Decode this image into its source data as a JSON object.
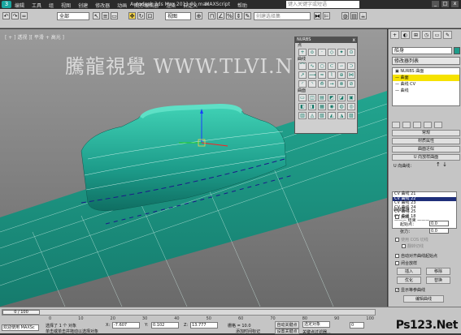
{
  "titlebar": {
    "logo": "3",
    "menus": [
      "编辑",
      "工具",
      "组",
      "视图",
      "创建",
      "修改器",
      "动画",
      "图形编辑器",
      "渲染",
      "自定义",
      "MAXScript",
      "帮助"
    ],
    "title": "Autodesk 3ds Max  2011     01.max",
    "search_placeholder": "键入关键字或短语",
    "min": "_",
    "max": "□",
    "close": "x"
  },
  "toolbar": {
    "selection_filter": "全部",
    "reference": "视图",
    "named_set": "创建选择集"
  },
  "viewport": {
    "label": "[ + ] 透视 ][ 平滑 + 高光 ]",
    "watermark": "騰龍視覺 WWW.TLVI.NET",
    "surface_color": "#1d9c8a"
  },
  "nurbs_panel": {
    "title": "NURBS",
    "point_label": "点",
    "curve_label": "曲线",
    "surface_label": "曲面",
    "close": "x",
    "point_tools": [
      "+",
      "o",
      "·",
      "◇",
      "✦",
      "⊙"
    ],
    "curve_tools": [
      "⌒",
      "∿",
      "○",
      "⊂",
      "∽",
      "⊃",
      "↗",
      "⟿",
      "≈",
      "⌇",
      "⊕",
      "⋈",
      "◜",
      "◝",
      "⟰",
      "⇝",
      "⊗",
      "⊘"
    ],
    "surface_tools": [
      "▭",
      "◫",
      "▤",
      "◩",
      "◪",
      "▣",
      "◧",
      "◨",
      "▦",
      "◉",
      "◍",
      "◎",
      "▥",
      "◬",
      "▧",
      "◭",
      "◮",
      "▨"
    ]
  },
  "command_panel": {
    "tabs": [
      "+",
      "◐",
      "⊞",
      "◷",
      "▭",
      "✎"
    ],
    "object_name": "船身",
    "object_color": "#1d9c8a",
    "modifier_list": "修改器列表",
    "stack": [
      {
        "label": "▣ NURBS 曲面",
        "selected": false
      },
      {
        "label": "— 曲面",
        "selected": true
      },
      {
        "label": "— 曲线 CV",
        "selected": false
      },
      {
        "label": "— 曲线",
        "selected": false
      }
    ],
    "rollouts": [
      "常规",
      "材质属性",
      "曲面近似",
      "U 向放样曲面"
    ],
    "u_curves_label": "U 向曲线：",
    "curves": [
      {
        "label": "CV 曲线 21",
        "selected": false
      },
      {
        "label": "CV 曲线 22",
        "selected": true
      },
      {
        "label": "CV 曲线 23",
        "selected": false
      },
      {
        "label": "CV 曲线 24",
        "selected": false
      },
      {
        "label": "CV 曲线 25",
        "selected": false
      },
      {
        "label": "CV 曲线 18",
        "selected": false
      },
      {
        "label": "——— 结束 ———",
        "selected": false
      }
    ],
    "curve_props_label": "曲线属性",
    "reverse_label": "反转",
    "start_point_label": "起始点：",
    "start_point_value": "0.0",
    "tension_label": "张力：",
    "tension_value": "0.0",
    "use_cos_label": "使用 COS 切线",
    "flip_label": "翻转切线",
    "auto_align_label": "自动对齐曲线起始点",
    "close_loft_label": "闭合放样",
    "insert_label": "插入",
    "remove_label": "移除",
    "refine_label": "优化",
    "replace_label": "替换",
    "display_iso_label": "显示等参曲线",
    "edit_curve_label": "编辑曲线"
  },
  "bottom": {
    "timeslider": "0 / 100",
    "ruler": [
      "0",
      "10",
      "20",
      "30",
      "40",
      "50",
      "60",
      "70",
      "80",
      "90",
      "100"
    ],
    "selected": "选择了 1 个 对象",
    "hint": "单击或单击并拖动以选择对象",
    "x_label": "X:",
    "x_value": "-7.607",
    "y_label": "Y:",
    "y_value": "0.102",
    "z_label": "Z:",
    "z_value": "13.777",
    "grid": "栅格 = 10.0",
    "auto_key": "自动关键点",
    "set_key": "设置关键点",
    "select_object": "选定对象",
    "key_filters": "关键点过滤器...",
    "add_time_tag": "添加时间标记",
    "welcome": "欢迎使用 MAXSc",
    "frame": "0",
    "brand": "Ps123.Net"
  }
}
